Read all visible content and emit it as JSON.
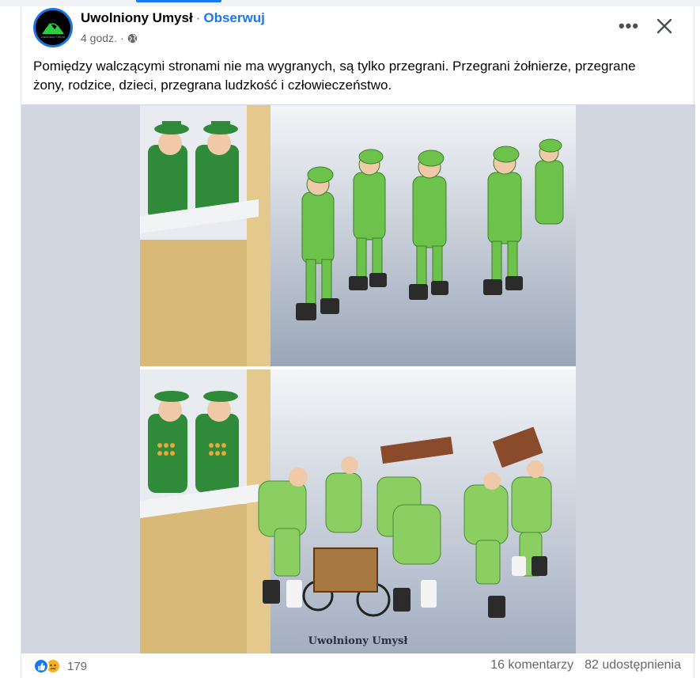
{
  "post": {
    "author": "Uwolniony Umysł",
    "separator": "·",
    "follow_label": "Obserwuj",
    "time": "4 godz.",
    "time_separator": "·",
    "privacy_icon": "globe-icon",
    "text": "Pomiędzy walczącymi stronami nie ma wygranych, są tylko przegrani. Przegrani żołnierze, przegrane żony, rodzice, dzieci, przegrana ludzkość i człowieczeństwo.",
    "more_icon": "more-options-icon",
    "more_label": "•••",
    "close_icon": "close-icon"
  },
  "avatar": {
    "logo_text": "Uwolniony Umysł"
  },
  "image": {
    "watermark": "Uwolniony Umysł"
  },
  "footer": {
    "reaction_icons": [
      "like-icon",
      "sad-icon"
    ],
    "reaction_count": "179",
    "comments": "16 komentarzy",
    "shares": "82 udostępnienia"
  },
  "colors": {
    "accent": "#1877f2",
    "secondary_text": "#65676b",
    "media_background": "#d1d6e0",
    "uniform_green": "#6cc24a",
    "officer_green": "#2f8a3a"
  }
}
